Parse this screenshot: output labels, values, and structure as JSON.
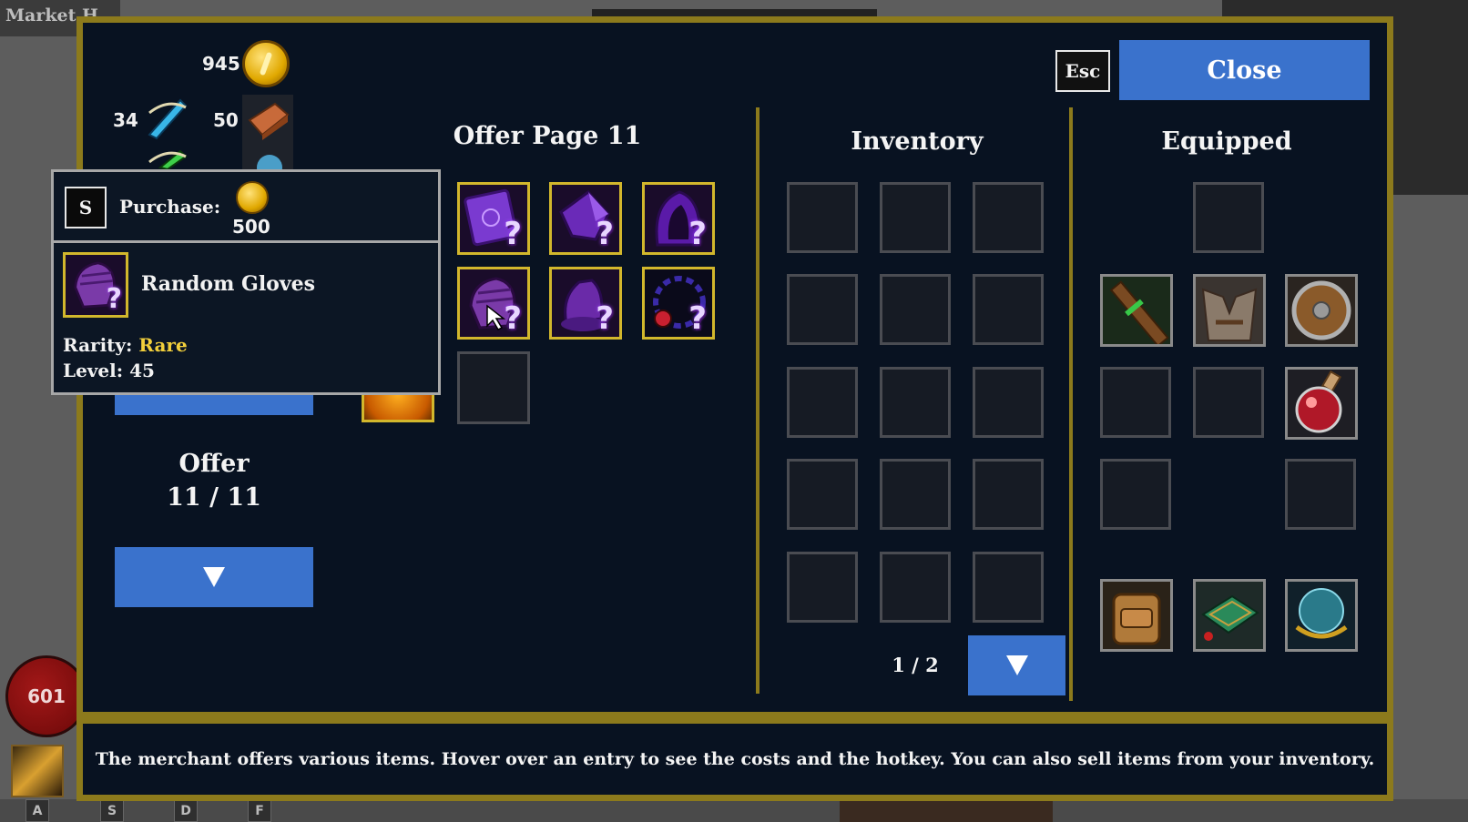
{
  "hud": {
    "location_title": "Market H",
    "health_value": "601",
    "hotkeys": [
      "A",
      "S",
      "D",
      "F"
    ]
  },
  "currencies": [
    {
      "amount": "945",
      "icon": "gold-coin-icon"
    },
    {
      "amount": "34",
      "icon": "blue-crystal-icon"
    },
    {
      "amount": "50",
      "icon": "copper-bar-icon"
    }
  ],
  "header": {
    "esc_label": "Esc",
    "close_label": "Close"
  },
  "offer_panel": {
    "title": "Offer Page 11",
    "items": [
      {
        "name": "random-tome",
        "icon": "purple-tome-icon",
        "qmark": "?"
      },
      {
        "name": "random-boots",
        "icon": "purple-boots-icon",
        "qmark": "?"
      },
      {
        "name": "random-hood",
        "icon": "purple-hood-icon",
        "qmark": "?"
      },
      {
        "name": "random-gloves",
        "icon": "purple-gloves-icon",
        "qmark": "?"
      },
      {
        "name": "random-armor",
        "icon": "purple-armor-icon",
        "qmark": "?"
      },
      {
        "name": "random-amulet",
        "icon": "purple-amulet-icon",
        "qmark": "?"
      }
    ],
    "offer_label": "Offer",
    "offer_count": "11 / 11"
  },
  "inventory": {
    "title": "Inventory",
    "page": "1 / 2"
  },
  "equipped": {
    "title": "Equipped",
    "items": [
      {
        "name": "wooden-staff",
        "icon": "staff-icon"
      },
      {
        "name": "fur-cloak",
        "icon": "cloak-icon"
      },
      {
        "name": "round-shield",
        "icon": "shield-icon"
      },
      {
        "name": "red-potion",
        "icon": "potion-icon"
      },
      {
        "name": "leather-backpack",
        "icon": "backpack-icon"
      },
      {
        "name": "green-chest",
        "icon": "chest-icon"
      },
      {
        "name": "crystal-orb",
        "icon": "orb-icon"
      }
    ]
  },
  "tooltip": {
    "hotkey": "S",
    "purchase_label": "Purchase:",
    "price": "500",
    "item_name": "Random Gloves",
    "rarity_label": "Rarity:",
    "rarity_value": "Rare",
    "level_label": "Level:",
    "level_value": "45",
    "qmark": "?"
  },
  "footer": {
    "text": "The merchant offers various items. Hover over an entry to see the costs and the hotkey. You can also sell items from your inventory."
  },
  "colors": {
    "panel_bg": "#081221",
    "border_gold": "#8c7a1c",
    "button_blue": "#3a72cc",
    "rarity_rare": "#f2cf3b",
    "offer_border": "#d2b72c"
  }
}
